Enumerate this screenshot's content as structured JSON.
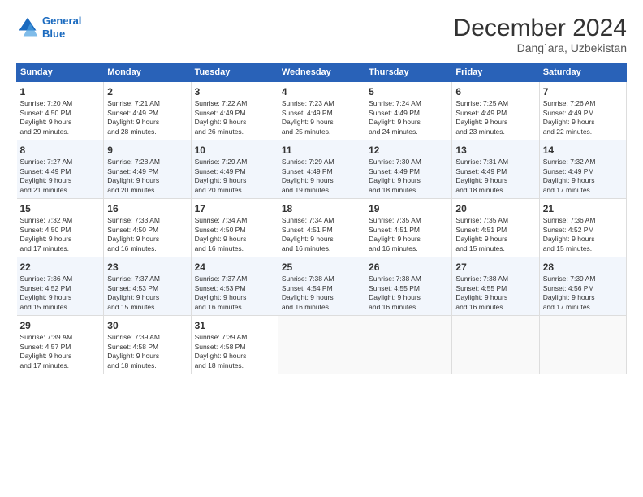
{
  "logo": {
    "line1": "General",
    "line2": "Blue"
  },
  "title": "December 2024",
  "subtitle": "Dang`ara, Uzbekistan",
  "days_header": [
    "Sunday",
    "Monday",
    "Tuesday",
    "Wednesday",
    "Thursday",
    "Friday",
    "Saturday"
  ],
  "weeks": [
    [
      {
        "day": "1",
        "lines": [
          "Sunrise: 7:20 AM",
          "Sunset: 4:50 PM",
          "Daylight: 9 hours",
          "and 29 minutes."
        ]
      },
      {
        "day": "2",
        "lines": [
          "Sunrise: 7:21 AM",
          "Sunset: 4:49 PM",
          "Daylight: 9 hours",
          "and 28 minutes."
        ]
      },
      {
        "day": "3",
        "lines": [
          "Sunrise: 7:22 AM",
          "Sunset: 4:49 PM",
          "Daylight: 9 hours",
          "and 26 minutes."
        ]
      },
      {
        "day": "4",
        "lines": [
          "Sunrise: 7:23 AM",
          "Sunset: 4:49 PM",
          "Daylight: 9 hours",
          "and 25 minutes."
        ]
      },
      {
        "day": "5",
        "lines": [
          "Sunrise: 7:24 AM",
          "Sunset: 4:49 PM",
          "Daylight: 9 hours",
          "and 24 minutes."
        ]
      },
      {
        "day": "6",
        "lines": [
          "Sunrise: 7:25 AM",
          "Sunset: 4:49 PM",
          "Daylight: 9 hours",
          "and 23 minutes."
        ]
      },
      {
        "day": "7",
        "lines": [
          "Sunrise: 7:26 AM",
          "Sunset: 4:49 PM",
          "Daylight: 9 hours",
          "and 22 minutes."
        ]
      }
    ],
    [
      {
        "day": "8",
        "lines": [
          "Sunrise: 7:27 AM",
          "Sunset: 4:49 PM",
          "Daylight: 9 hours",
          "and 21 minutes."
        ]
      },
      {
        "day": "9",
        "lines": [
          "Sunrise: 7:28 AM",
          "Sunset: 4:49 PM",
          "Daylight: 9 hours",
          "and 20 minutes."
        ]
      },
      {
        "day": "10",
        "lines": [
          "Sunrise: 7:29 AM",
          "Sunset: 4:49 PM",
          "Daylight: 9 hours",
          "and 20 minutes."
        ]
      },
      {
        "day": "11",
        "lines": [
          "Sunrise: 7:29 AM",
          "Sunset: 4:49 PM",
          "Daylight: 9 hours",
          "and 19 minutes."
        ]
      },
      {
        "day": "12",
        "lines": [
          "Sunrise: 7:30 AM",
          "Sunset: 4:49 PM",
          "Daylight: 9 hours",
          "and 18 minutes."
        ]
      },
      {
        "day": "13",
        "lines": [
          "Sunrise: 7:31 AM",
          "Sunset: 4:49 PM",
          "Daylight: 9 hours",
          "and 18 minutes."
        ]
      },
      {
        "day": "14",
        "lines": [
          "Sunrise: 7:32 AM",
          "Sunset: 4:49 PM",
          "Daylight: 9 hours",
          "and 17 minutes."
        ]
      }
    ],
    [
      {
        "day": "15",
        "lines": [
          "Sunrise: 7:32 AM",
          "Sunset: 4:50 PM",
          "Daylight: 9 hours",
          "and 17 minutes."
        ]
      },
      {
        "day": "16",
        "lines": [
          "Sunrise: 7:33 AM",
          "Sunset: 4:50 PM",
          "Daylight: 9 hours",
          "and 16 minutes."
        ]
      },
      {
        "day": "17",
        "lines": [
          "Sunrise: 7:34 AM",
          "Sunset: 4:50 PM",
          "Daylight: 9 hours",
          "and 16 minutes."
        ]
      },
      {
        "day": "18",
        "lines": [
          "Sunrise: 7:34 AM",
          "Sunset: 4:51 PM",
          "Daylight: 9 hours",
          "and 16 minutes."
        ]
      },
      {
        "day": "19",
        "lines": [
          "Sunrise: 7:35 AM",
          "Sunset: 4:51 PM",
          "Daylight: 9 hours",
          "and 16 minutes."
        ]
      },
      {
        "day": "20",
        "lines": [
          "Sunrise: 7:35 AM",
          "Sunset: 4:51 PM",
          "Daylight: 9 hours",
          "and 15 minutes."
        ]
      },
      {
        "day": "21",
        "lines": [
          "Sunrise: 7:36 AM",
          "Sunset: 4:52 PM",
          "Daylight: 9 hours",
          "and 15 minutes."
        ]
      }
    ],
    [
      {
        "day": "22",
        "lines": [
          "Sunrise: 7:36 AM",
          "Sunset: 4:52 PM",
          "Daylight: 9 hours",
          "and 15 minutes."
        ]
      },
      {
        "day": "23",
        "lines": [
          "Sunrise: 7:37 AM",
          "Sunset: 4:53 PM",
          "Daylight: 9 hours",
          "and 15 minutes."
        ]
      },
      {
        "day": "24",
        "lines": [
          "Sunrise: 7:37 AM",
          "Sunset: 4:53 PM",
          "Daylight: 9 hours",
          "and 16 minutes."
        ]
      },
      {
        "day": "25",
        "lines": [
          "Sunrise: 7:38 AM",
          "Sunset: 4:54 PM",
          "Daylight: 9 hours",
          "and 16 minutes."
        ]
      },
      {
        "day": "26",
        "lines": [
          "Sunrise: 7:38 AM",
          "Sunset: 4:55 PM",
          "Daylight: 9 hours",
          "and 16 minutes."
        ]
      },
      {
        "day": "27",
        "lines": [
          "Sunrise: 7:38 AM",
          "Sunset: 4:55 PM",
          "Daylight: 9 hours",
          "and 16 minutes."
        ]
      },
      {
        "day": "28",
        "lines": [
          "Sunrise: 7:39 AM",
          "Sunset: 4:56 PM",
          "Daylight: 9 hours",
          "and 17 minutes."
        ]
      }
    ],
    [
      {
        "day": "29",
        "lines": [
          "Sunrise: 7:39 AM",
          "Sunset: 4:57 PM",
          "Daylight: 9 hours",
          "and 17 minutes."
        ]
      },
      {
        "day": "30",
        "lines": [
          "Sunrise: 7:39 AM",
          "Sunset: 4:58 PM",
          "Daylight: 9 hours",
          "and 18 minutes."
        ]
      },
      {
        "day": "31",
        "lines": [
          "Sunrise: 7:39 AM",
          "Sunset: 4:58 PM",
          "Daylight: 9 hours",
          "and 18 minutes."
        ]
      },
      null,
      null,
      null,
      null
    ]
  ]
}
